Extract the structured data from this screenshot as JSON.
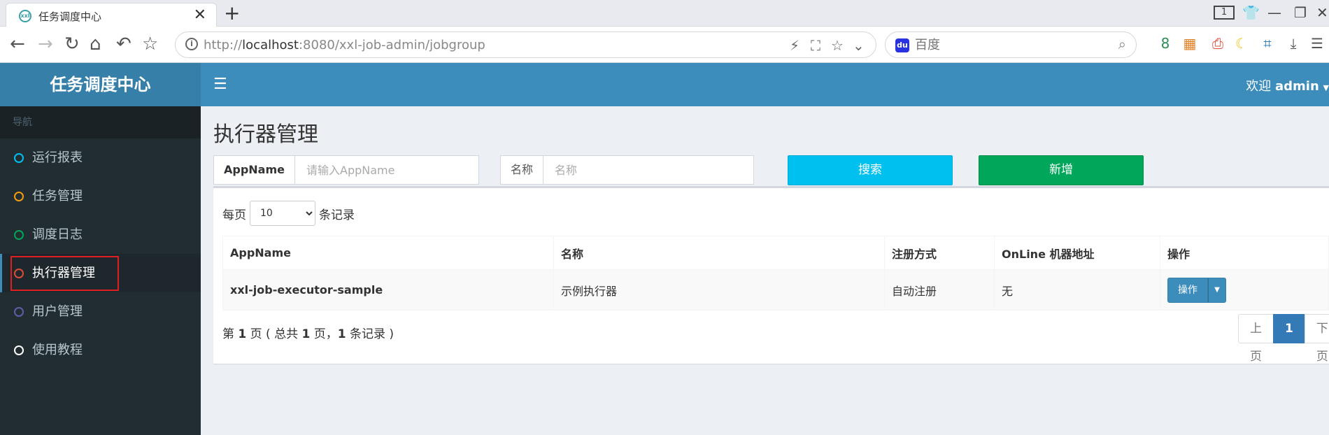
{
  "browser": {
    "tab_title": "任务调度中心",
    "tab_favicon_text": "xxl",
    "tab_close": "✕",
    "new_tab": "+",
    "tab_count": "1",
    "url_prefix": "http://",
    "url_host": "localhost",
    "url_rest": ":8080/xxl-job-admin/jobgroup",
    "search_placeholder": "百度"
  },
  "app": {
    "logo": "任务调度中心",
    "welcome": "欢迎",
    "user": "admin"
  },
  "sidebar": {
    "header": "导航",
    "items": [
      {
        "label": "运行报表",
        "color": "#00c0ef"
      },
      {
        "label": "任务管理",
        "color": "#f39c12"
      },
      {
        "label": "调度日志",
        "color": "#00a65a"
      },
      {
        "label": "执行器管理",
        "color": "#dd4b39"
      },
      {
        "label": "用户管理",
        "color": "#605ca8"
      },
      {
        "label": "使用教程",
        "color": "#ffffff"
      }
    ],
    "active_index": 3
  },
  "page": {
    "title": "执行器管理",
    "filter": {
      "appname_label": "AppName",
      "appname_placeholder": "请输入AppName",
      "name_label": "名称",
      "name_placeholder": "名称",
      "search_button": "搜索",
      "add_button": "新增"
    },
    "length": {
      "prefix": "每页",
      "value": "10",
      "suffix": "条记录"
    },
    "table": {
      "columns": [
        "AppName",
        "名称",
        "注册方式",
        "OnLine 机器地址",
        "操作"
      ],
      "rows": [
        {
          "appname": "xxl-job-executor-sample",
          "name": "示例执行器",
          "reg_type": "自动注册",
          "online": "无",
          "action": "操作"
        }
      ]
    },
    "info": {
      "p1": "第 ",
      "page": "1",
      "p2": " 页 ( 总共 ",
      "total_pages": "1",
      "p3": " 页，",
      "records": "1",
      "p4": " 条记录 )"
    },
    "pager": {
      "prev": "上页",
      "current": "1",
      "next": "下页"
    }
  },
  "colors": {
    "header_blue": "#3c8dbc",
    "logo_blue": "#367fa9",
    "sidebar_dark": "#222d32",
    "search_btn": "#00c0ef",
    "add_btn": "#00a65a",
    "highlight": "#e02020"
  }
}
